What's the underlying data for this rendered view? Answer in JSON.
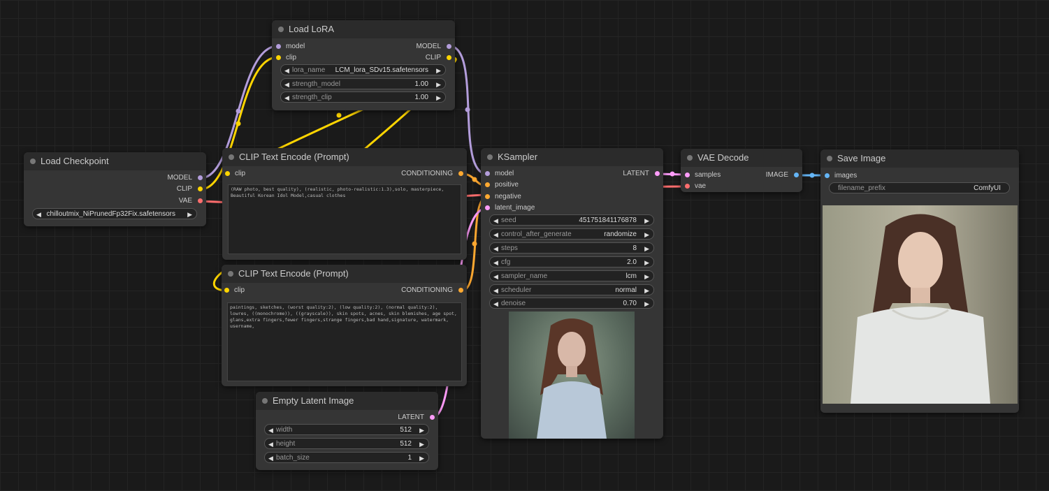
{
  "colors": {
    "model": "#b39ddb",
    "clip": "#ffd500",
    "vae": "#ff6e6e",
    "conditioning": "#ffa931",
    "latent": "#ff9cf9",
    "image": "#64b5f6"
  },
  "nodes": {
    "load_lora": {
      "title": "Load LoRA",
      "inputs": [
        "model",
        "clip"
      ],
      "outputs": [
        "MODEL",
        "CLIP"
      ],
      "widgets": [
        {
          "name": "lora_name",
          "value": "LCM_lora_SDv15.safetensors"
        },
        {
          "name": "strength_model",
          "value": "1.00"
        },
        {
          "name": "strength_clip",
          "value": "1.00"
        }
      ]
    },
    "load_checkpoint": {
      "title": "Load Checkpoint",
      "outputs": [
        "MODEL",
        "CLIP",
        "VAE"
      ],
      "ckpt_name": "chilloutmix_NiPrunedFp32Fix.safetensors"
    },
    "clip_pos": {
      "title": "CLIP Text Encode (Prompt)",
      "input": "clip",
      "output": "CONDITIONING",
      "text": "(RAW photo, best quality), (realistic, photo-realistic:1.3),solo, masterpiece, Beautiful Korean Idol Model,casual clothes"
    },
    "clip_neg": {
      "title": "CLIP Text Encode (Prompt)",
      "input": "clip",
      "output": "CONDITIONING",
      "text": "paintings, sketches, (worst quality:2), (low quality:2), (normal quality:2), lowres, ((monochrome)), ((grayscale)), skin spots, acnes, skin blemishes, age spot, glans,extra fingers,fewer fingers,strange fingers,bad hand,signature, watermark, username,"
    },
    "empty_latent": {
      "title": "Empty Latent Image",
      "output": "LATENT",
      "widgets": [
        {
          "name": "width",
          "value": "512"
        },
        {
          "name": "height",
          "value": "512"
        },
        {
          "name": "batch_size",
          "value": "1"
        }
      ]
    },
    "ksampler": {
      "title": "KSampler",
      "inputs": [
        "model",
        "positive",
        "negative",
        "latent_image"
      ],
      "output": "LATENT",
      "widgets": [
        {
          "name": "seed",
          "value": "451751841176878"
        },
        {
          "name": "control_after_generate",
          "value": "randomize"
        },
        {
          "name": "steps",
          "value": "8"
        },
        {
          "name": "cfg",
          "value": "2.0"
        },
        {
          "name": "sampler_name",
          "value": "lcm"
        },
        {
          "name": "scheduler",
          "value": "normal"
        },
        {
          "name": "denoise",
          "value": "0.70"
        }
      ]
    },
    "vae_decode": {
      "title": "VAE Decode",
      "inputs": [
        "samples",
        "vae"
      ],
      "output": "IMAGE"
    },
    "save_image": {
      "title": "Save Image",
      "input": "images",
      "filename_prefix_label": "filename_prefix",
      "filename_prefix": "ComfyUI"
    }
  }
}
